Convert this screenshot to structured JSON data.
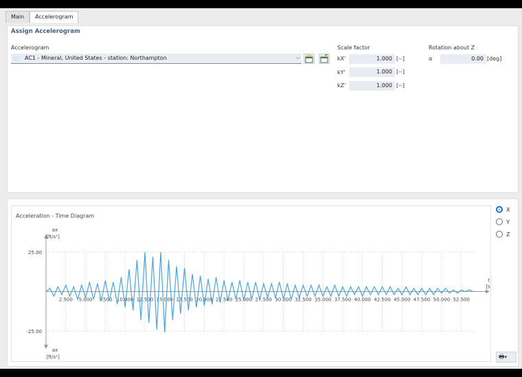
{
  "tabs": [
    {
      "label": "Main",
      "active": false
    },
    {
      "label": "Accelerogram",
      "active": true
    }
  ],
  "assign": {
    "title": "Assign Accelerogram",
    "accelerogram_label": "Accelerogram",
    "accelerogram_value": "AC1 - Mineral, United States - station: Northampton",
    "scale_factor_label": "Scale factor",
    "rotation_label": "Rotation about Z",
    "factors": [
      {
        "symbol": "kX'",
        "value": "1.000",
        "unit": "[--]"
      },
      {
        "symbol": "kY'",
        "value": "1.000",
        "unit": "[--]"
      },
      {
        "symbol": "kZ'",
        "value": "1.000",
        "unit": "[--]"
      }
    ],
    "rotation": {
      "symbol": "α",
      "value": "0.00",
      "unit": "[deg]"
    }
  },
  "diagram": {
    "title": "Acceleration - Time Diagram",
    "radios": [
      {
        "label": "X",
        "selected": true
      },
      {
        "label": "Y",
        "selected": false
      },
      {
        "label": "Z",
        "selected": false
      }
    ],
    "print_icon": "printer-icon"
  },
  "chart_data": {
    "type": "line",
    "title": "Acceleration - Time Diagram",
    "xlabel": "t",
    "xunit": "[s]",
    "ylabel": "ax",
    "yunit": "[ft/s²]",
    "xlim": [
      0,
      54
    ],
    "ylim": [
      -25,
      25
    ],
    "y_ticks": [
      "25.00",
      "-25.00"
    ],
    "x_ticks": [
      "2.500",
      "5.000",
      "7.500",
      "10.000",
      "12.500",
      "15.000",
      "17.500",
      "20.000",
      "22.500",
      "25.000",
      "27.500",
      "30.000",
      "32.500",
      "35.000",
      "37.500",
      "40.000",
      "42.500",
      "45.000",
      "47.500",
      "50.000",
      "52.500"
    ],
    "series": [
      {
        "color": "#4aa3df",
        "x": [
          0,
          0.5,
          1,
          1.5,
          2,
          2.5,
          3,
          3.5,
          4,
          4.5,
          5,
          5.5,
          6,
          6.5,
          7,
          7.5,
          8,
          8.5,
          9,
          9.5,
          10,
          10.5,
          11,
          11.5,
          12,
          12.5,
          13,
          13.5,
          14,
          14.5,
          15,
          15.5,
          16,
          16.5,
          17,
          17.5,
          18,
          18.5,
          19,
          19.5,
          20,
          20.5,
          21,
          21.5,
          22,
          22.5,
          23,
          23.5,
          24,
          24.5,
          25,
          25.5,
          26,
          26.5,
          27,
          27.5,
          28,
          28.5,
          29,
          29.5,
          30,
          30.5,
          31,
          31.5,
          32,
          32.5,
          33,
          33.5,
          34,
          34.5,
          35,
          35.5,
          36,
          36.5,
          37,
          37.5,
          38,
          38.5,
          39,
          39.5,
          40,
          40.5,
          41,
          41.5,
          42,
          42.5,
          43,
          43.5,
          44,
          44.5,
          45,
          45.5,
          46,
          46.5,
          47,
          47.5,
          48,
          48.5,
          49,
          49.5,
          50,
          50.5,
          51,
          51.5,
          52,
          52.5,
          53,
          53.5,
          54
        ],
        "y": [
          0,
          2,
          -3,
          3,
          -2,
          4,
          -3,
          3,
          -5,
          4,
          -4,
          6,
          -5,
          5,
          -6,
          7,
          -6,
          6,
          -8,
          9,
          -10,
          14,
          -12,
          20,
          -18,
          25,
          -20,
          22,
          -24,
          25,
          -26,
          20,
          -18,
          16,
          -14,
          15,
          -12,
          11,
          -10,
          10,
          -9,
          8,
          -8,
          9,
          -7,
          7,
          -6,
          6,
          -5,
          7,
          -6,
          6,
          -5,
          6,
          -5,
          5,
          -4,
          5,
          -4,
          6,
          -5,
          5,
          -5,
          4,
          -4,
          4,
          -3,
          4,
          -3,
          4,
          -3,
          3,
          -3,
          4,
          -3,
          3,
          -3,
          3,
          -2,
          3,
          -3,
          3,
          -2,
          3,
          -2,
          3,
          -2,
          3,
          -2,
          2,
          -2,
          3,
          -2,
          2,
          -2,
          2,
          -2,
          2,
          -2,
          2,
          -1,
          2,
          -1,
          1,
          -1,
          1,
          0,
          1,
          0
        ]
      }
    ]
  }
}
